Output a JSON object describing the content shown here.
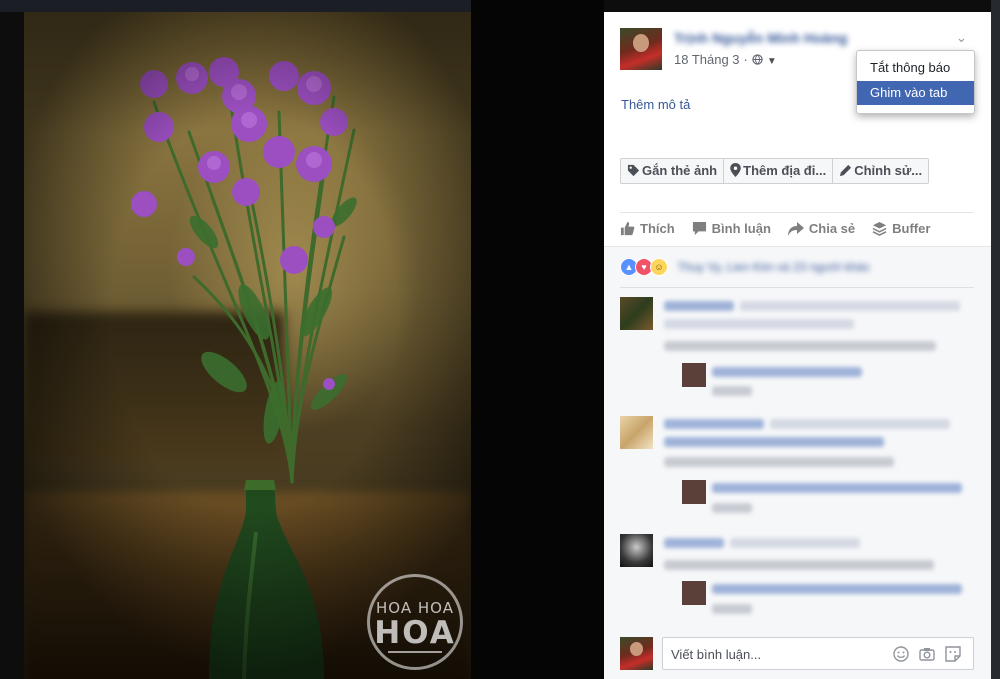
{
  "post": {
    "author_name": "Trịnh Nguyễn Minh Hoàng",
    "date": "18 Tháng 3",
    "separator": "·",
    "add_description": "Thêm mô tả"
  },
  "dropdown_menu": {
    "items": [
      {
        "label": "Tắt thông báo"
      },
      {
        "label": "Ghim vào tab"
      }
    ],
    "selected_index": 1
  },
  "photo_actions": [
    {
      "label": "Gắn thẻ ảnh",
      "icon": "tag-icon"
    },
    {
      "label": "Thêm địa đi...",
      "icon": "location-pin-icon"
    },
    {
      "label": "Chỉnh sử...",
      "icon": "pencil-icon"
    }
  ],
  "ufi": [
    {
      "label": "Thích",
      "icon": "like-icon"
    },
    {
      "label": "Bình luận",
      "icon": "comment-icon"
    },
    {
      "label": "Chia sẻ",
      "icon": "share-icon"
    },
    {
      "label": "Buffer",
      "icon": "buffer-icon"
    }
  ],
  "reactions": {
    "types": [
      "like",
      "love",
      "haha"
    ],
    "summary": "Thuy Vy, Lien Kim và 23 người khác"
  },
  "comment_input": {
    "placeholder": "Viết bình luận..."
  },
  "photo": {
    "watermark_line1": "HOA HOA",
    "watermark_line2": "HOA"
  },
  "colors": {
    "link_blue": "#365899",
    "menu_highlight": "#4267b2",
    "panel_bg": "#ffffff",
    "comments_bg": "#f6f7f9",
    "stage_bg": "#0d0d0d"
  }
}
